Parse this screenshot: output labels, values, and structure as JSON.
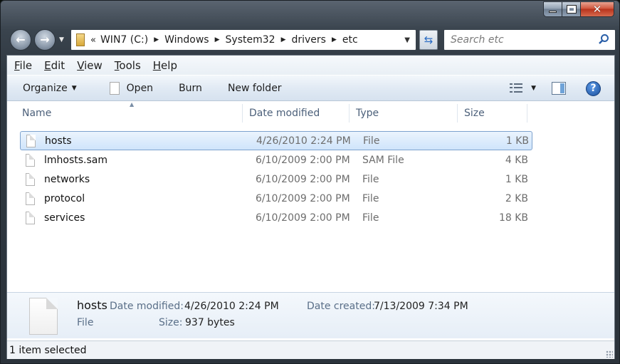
{
  "window": {
    "caption_buttons": {
      "minimize": "minimize",
      "maximize": "maximize",
      "close": "close"
    }
  },
  "nav": {
    "address": {
      "lead": "«",
      "crumbs": [
        "WIN7 (C:)",
        "Windows",
        "System32",
        "drivers",
        "etc"
      ]
    },
    "search": {
      "placeholder": "Search etc"
    }
  },
  "menubar": {
    "items": [
      {
        "key": "F",
        "rest": "ile"
      },
      {
        "key": "E",
        "rest": "dit"
      },
      {
        "key": "V",
        "rest": "iew"
      },
      {
        "key": "T",
        "rest": "ools"
      },
      {
        "key": "H",
        "rest": "elp"
      }
    ]
  },
  "toolbar": {
    "organize": "Organize",
    "open": "Open",
    "burn": "Burn",
    "new_folder": "New folder",
    "help": "?"
  },
  "columns": [
    "Name",
    "Date modified",
    "Type",
    "Size"
  ],
  "files": [
    {
      "name": "hosts",
      "date": "4/26/2010 2:24 PM",
      "type": "File",
      "size": "1 KB",
      "selected": true
    },
    {
      "name": "lmhosts.sam",
      "date": "6/10/2009 2:00 PM",
      "type": "SAM File",
      "size": "4 KB",
      "selected": false
    },
    {
      "name": "networks",
      "date": "6/10/2009 2:00 PM",
      "type": "File",
      "size": "1 KB",
      "selected": false
    },
    {
      "name": "protocol",
      "date": "6/10/2009 2:00 PM",
      "type": "File",
      "size": "2 KB",
      "selected": false
    },
    {
      "name": "services",
      "date": "6/10/2009 2:00 PM",
      "type": "File",
      "size": "18 KB",
      "selected": false
    }
  ],
  "details": {
    "name": "hosts",
    "kind": "File",
    "date_modified_label": "Date modified:",
    "date_modified": "4/26/2010 2:24 PM",
    "date_created_label": "Date created:",
    "date_created": "7/13/2009 7:34 PM",
    "size_label": "Size:",
    "size": "937 bytes"
  },
  "status": {
    "text": "1 item selected"
  }
}
